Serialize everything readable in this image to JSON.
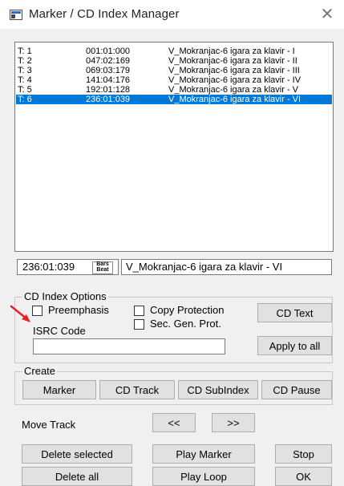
{
  "window": {
    "title": "Marker / CD Index Manager"
  },
  "marker_list": {
    "rows": [
      {
        "track": "T: 1",
        "time": "001:01:000",
        "title": "V_Mokranjac-6 igara za klavir - I",
        "selected": false
      },
      {
        "track": "T: 2",
        "time": "047:02:169",
        "title": "V_Mokranjac-6 igara za klavir - II",
        "selected": false
      },
      {
        "track": "T: 3",
        "time": "069:03:179",
        "title": "V_Mokranjac-6 igara za klavir - III",
        "selected": false
      },
      {
        "track": "T: 4",
        "time": "141:04:176",
        "title": "V_Mokranjac-6 igara za klavir - IV",
        "selected": false
      },
      {
        "track": "T: 5",
        "time": "192:01:128",
        "title": "V_Mokranjac-6 igara za klavir - V",
        "selected": false
      },
      {
        "track": "T: 6",
        "time": "236:01:039",
        "title": "V_Mokranjac-6 igara za klavir - VI",
        "selected": true
      }
    ]
  },
  "current_marker": {
    "time": "236:01:039",
    "badge_top": "Bars",
    "badge_bottom": "Beat",
    "title": "V_Mokranjac-6 igara za klavir - VI"
  },
  "cd_index_options": {
    "group_label": "CD Index Options",
    "preemphasis_label": "Preemphasis",
    "preemphasis_checked": false,
    "copy_protection_label": "Copy Protection",
    "copy_protection_checked": false,
    "sec_gen_prot_label": "Sec. Gen. Prot.",
    "sec_gen_prot_checked": false,
    "cd_text_button": "CD Text",
    "isrc_label": "ISRC Code",
    "isrc_value": "",
    "apply_to_all_button": "Apply to all"
  },
  "create": {
    "group_label": "Create",
    "marker_button": "Marker",
    "cd_track_button": "CD Track",
    "cd_subindex_button": "CD SubIndex",
    "cd_pause_button": "CD Pause"
  },
  "move_track": {
    "label": "Move Track",
    "prev_button": "<<",
    "next_button": ">>"
  },
  "actions": {
    "delete_selected": "Delete selected",
    "play_marker": "Play Marker",
    "stop": "Stop",
    "delete_all": "Delete all",
    "play_loop": "Play Loop",
    "ok": "OK"
  },
  "annotation": {
    "arrow_color": "#e8201e"
  },
  "colors": {
    "selection": "#0078d7",
    "window_bg": "#f0f0f0"
  }
}
